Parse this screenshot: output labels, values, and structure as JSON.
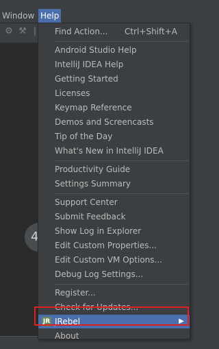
{
  "menubar": {
    "window_label": "Window",
    "help_label": "Help"
  },
  "background": {
    "badge_text": "4"
  },
  "help_menu": {
    "groups": [
      [
        {
          "label": "Find Action...",
          "shortcut": "Ctrl+Shift+A"
        }
      ],
      [
        {
          "label": "Android Studio Help"
        },
        {
          "label": "IntelliJ IDEA Help"
        },
        {
          "label": "Getting Started"
        },
        {
          "label": "Licenses"
        },
        {
          "label": "Keymap Reference"
        },
        {
          "label": "Demos and Screencasts"
        },
        {
          "label": "Tip of the Day"
        },
        {
          "label": "What's New in IntelliJ IDEA"
        }
      ],
      [
        {
          "label": "Productivity Guide"
        },
        {
          "label": "Settings Summary"
        }
      ],
      [
        {
          "label": "Support Center"
        },
        {
          "label": "Submit Feedback"
        },
        {
          "label": "Show Log in Explorer"
        },
        {
          "label": "Edit Custom Properties..."
        },
        {
          "label": "Edit Custom VM Options..."
        },
        {
          "label": "Debug Log Settings..."
        }
      ],
      [
        {
          "label": "Register..."
        },
        {
          "label": "Check for Updates..."
        },
        {
          "label": "JRebel",
          "selected": true,
          "submenu": true,
          "icon": "jrebel-icon"
        },
        {
          "label": "About"
        }
      ]
    ]
  },
  "colors": {
    "menu_bg": "#3c3f41",
    "selection": "#4b6eaf",
    "annotation_box": "#e02020"
  }
}
